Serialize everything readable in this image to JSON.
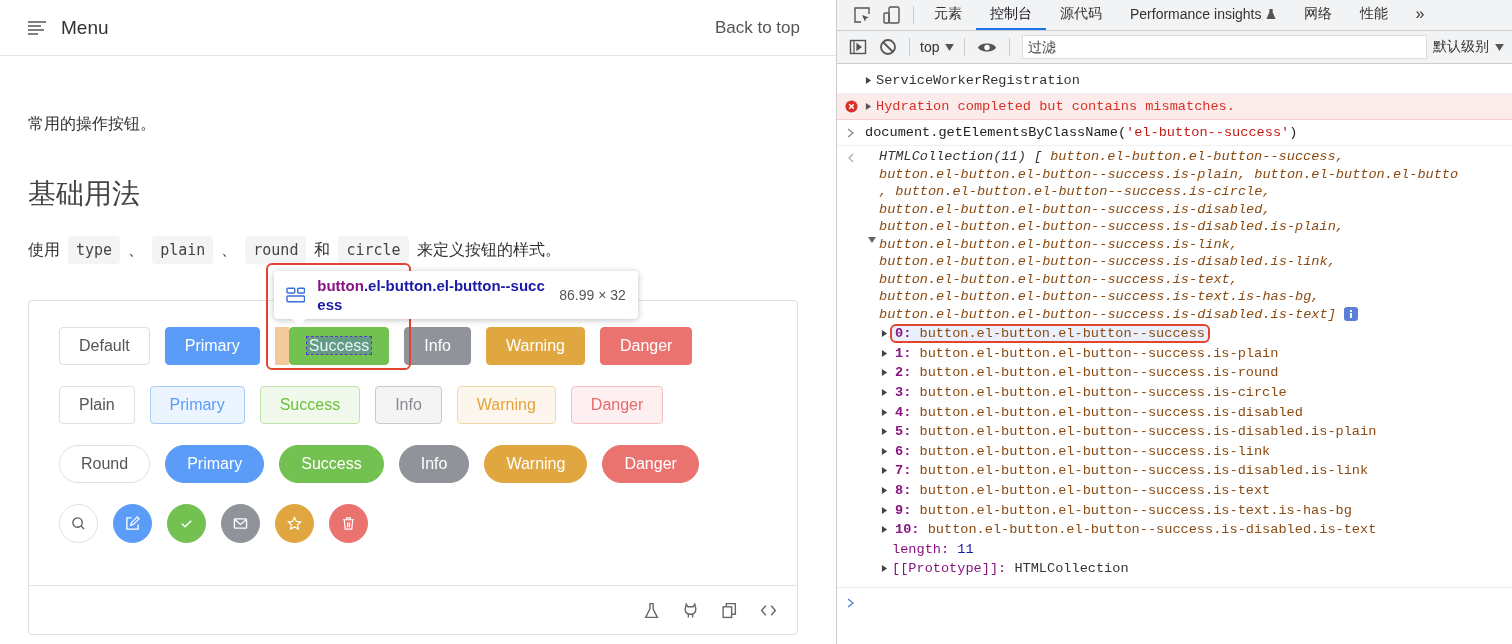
{
  "docs": {
    "menu_label": "Menu",
    "back_to_top": "Back to top",
    "intro": "常用的操作按钮。",
    "section_title": "基础用法",
    "usage": [
      {
        "kind": "text",
        "text": "使用"
      },
      {
        "kind": "code",
        "text": "type"
      },
      {
        "kind": "text",
        "text": "、"
      },
      {
        "kind": "code",
        "text": "plain"
      },
      {
        "kind": "text",
        "text": "、"
      },
      {
        "kind": "code",
        "text": "round"
      },
      {
        "kind": "text",
        "text": "和"
      },
      {
        "kind": "code",
        "text": "circle"
      },
      {
        "kind": "text",
        "text": "来定义按钮的样式。"
      }
    ],
    "rows": [
      {
        "kind": "solid",
        "buttons": [
          {
            "kind": "default",
            "label": "Default",
            "inspected": false
          },
          {
            "kind": "primary",
            "label": "Primary",
            "inspected": false
          },
          {
            "kind": "success",
            "label": "Success",
            "inspected": true
          },
          {
            "kind": "info",
            "label": "Info",
            "inspected": false
          },
          {
            "kind": "warning",
            "label": "Warning",
            "inspected": false
          },
          {
            "kind": "danger",
            "label": "Danger",
            "inspected": false
          }
        ]
      },
      {
        "kind": "plain",
        "buttons": [
          {
            "kind": "default",
            "label": "Plain",
            "inspected": false
          },
          {
            "kind": "primary",
            "label": "Primary",
            "inspected": false
          },
          {
            "kind": "success",
            "label": "Success",
            "inspected": false
          },
          {
            "kind": "info",
            "label": "Info",
            "inspected": false
          },
          {
            "kind": "warning",
            "label": "Warning",
            "inspected": false
          },
          {
            "kind": "danger",
            "label": "Danger",
            "inspected": false
          }
        ]
      },
      {
        "kind": "round",
        "buttons": [
          {
            "kind": "default",
            "label": "Round",
            "inspected": false
          },
          {
            "kind": "primary",
            "label": "Primary",
            "inspected": false
          },
          {
            "kind": "success",
            "label": "Success",
            "inspected": false
          },
          {
            "kind": "info",
            "label": "Info",
            "inspected": false
          },
          {
            "kind": "warning",
            "label": "Warning",
            "inspected": false
          },
          {
            "kind": "danger",
            "label": "Danger",
            "inspected": false
          }
        ]
      },
      {
        "kind": "circle",
        "buttons": [
          {
            "kind": "default",
            "inspected": false
          },
          {
            "kind": "primary",
            "inspected": false
          },
          {
            "kind": "success",
            "inspected": false
          },
          {
            "kind": "info",
            "inspected": false
          },
          {
            "kind": "warning",
            "inspected": false
          },
          {
            "kind": "danger",
            "inspected": false
          }
        ]
      }
    ],
    "inspector": {
      "tag": "button",
      "classes": ".el-button.el-button--success",
      "size": "86.99 × 32"
    }
  },
  "devtools": {
    "tabs": [
      {
        "label": "元素",
        "selected": false,
        "experimental": false
      },
      {
        "label": "控制台",
        "selected": true,
        "experimental": false
      },
      {
        "label": "源代码",
        "selected": false,
        "experimental": false
      },
      {
        "label": "Performance insights",
        "selected": false,
        "experimental": true
      },
      {
        "label": "网络",
        "selected": false,
        "experimental": false
      },
      {
        "label": "性能",
        "selected": false,
        "experimental": false
      }
    ],
    "more": "»",
    "context": "top",
    "filter_placeholder": "过滤",
    "level": "默认级别",
    "entries": [
      {
        "kind": "object",
        "text": "ServiceWorkerRegistration"
      },
      {
        "kind": "error",
        "text": "Hydration completed but contains mismatches."
      },
      {
        "kind": "input",
        "text": "document.getElementsByClassName(",
        "argument": "'el-button--success'",
        "suffix": ")"
      }
    ],
    "result": {
      "head": "HTMLCollection(11) [",
      "expanded": true,
      "preview": [
        "button.el-button.el-button--success,",
        "button.el-button.el-button--success.is-plain, button.el-button.el-butto",
        ", button.el-button.el-button--success.is-circle,",
        "button.el-button.el-button--success.is-disabled,",
        "button.el-button.el-button--success.is-disabled.is-plain,",
        "button.el-button.el-button--success.is-link,",
        "button.el-button.el-button--success.is-disabled.is-link,",
        "button.el-button.el-button--success.is-text,",
        "button.el-button.el-button--success.is-text.is-has-bg,",
        "button.el-button.el-button--success.is-disabled.is-text]"
      ],
      "items": [
        {
          "index": "0:",
          "text": "button.el-button.el-button--success",
          "highlighted": true
        },
        {
          "index": "1:",
          "text": "button.el-button.el-button--success.is-plain",
          "highlighted": false
        },
        {
          "index": "2:",
          "text": "button.el-button.el-button--success.is-round",
          "highlighted": false
        },
        {
          "index": "3:",
          "text": "button.el-button.el-button--success.is-circle",
          "highlighted": false
        },
        {
          "index": "4:",
          "text": "button.el-button.el-button--success.is-disabled",
          "highlighted": false
        },
        {
          "index": "5:",
          "text": "button.el-button.el-button--success.is-disabled.is-plain",
          "highlighted": false
        },
        {
          "index": "6:",
          "text": "button.el-button.el-button--success.is-link",
          "highlighted": false
        },
        {
          "index": "7:",
          "text": "button.el-button.el-button--success.is-disabled.is-link",
          "highlighted": false
        },
        {
          "index": "8:",
          "text": "button.el-button.el-button--success.is-text",
          "highlighted": false
        },
        {
          "index": "9:",
          "text": "button.el-button.el-button--success.is-text.is-has-bg",
          "highlighted": false
        },
        {
          "index": "10:",
          "text": "button.el-button.el-button--success.is-disabled.is-text",
          "highlighted": false
        }
      ],
      "length_key": "length:",
      "length_value": "11",
      "proto_key": "[[Prototype]]:",
      "proto_value": "HTMLCollection"
    }
  }
}
